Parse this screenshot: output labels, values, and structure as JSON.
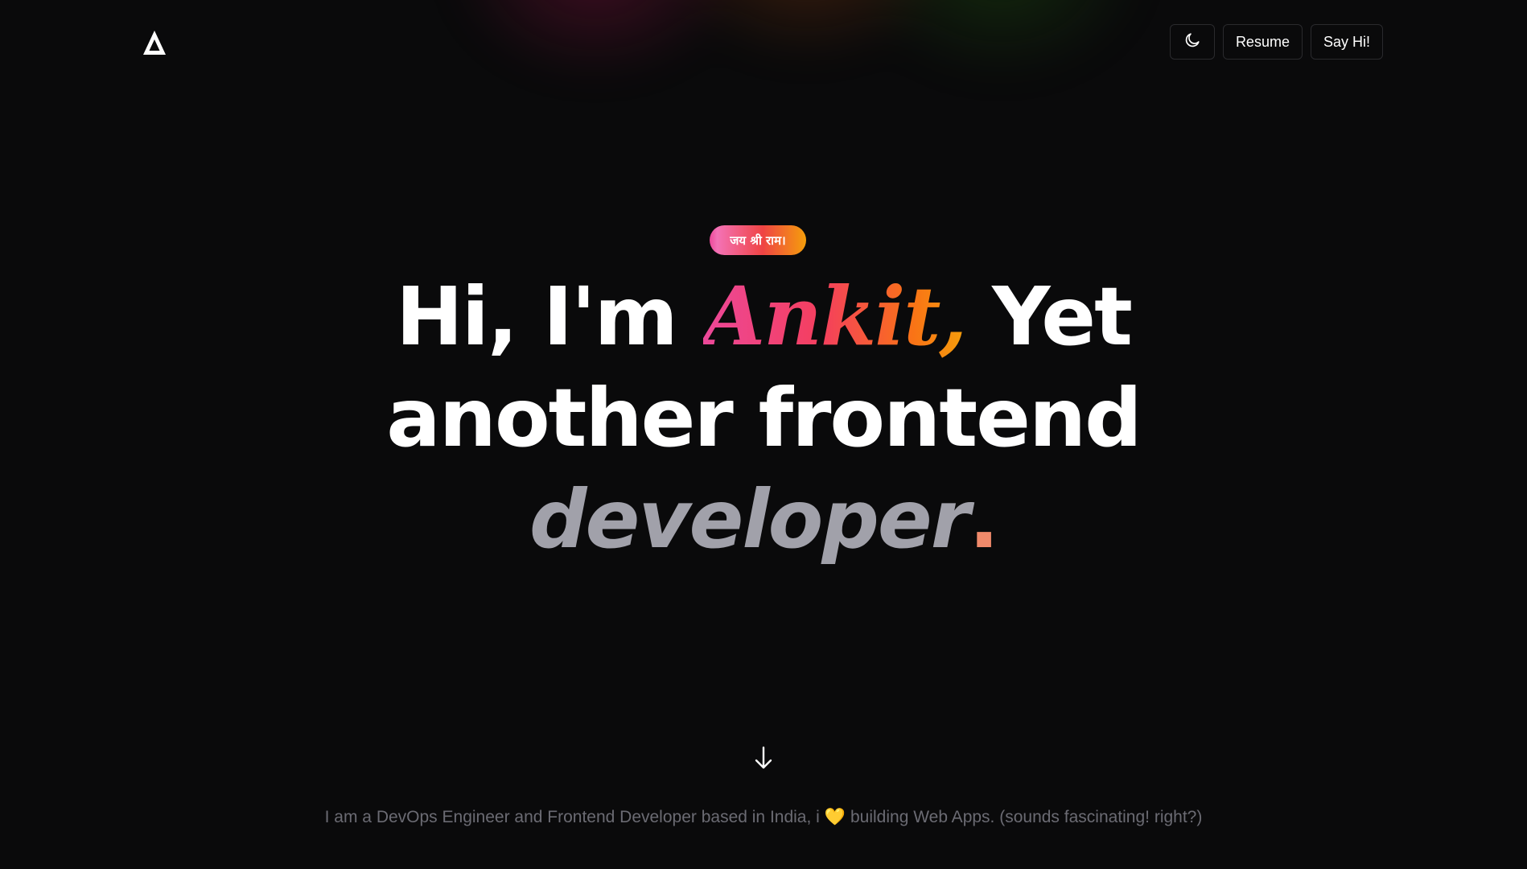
{
  "header": {
    "theme_toggle_icon": "moon-icon",
    "resume_label": "Resume",
    "say_hi_label": "Say Hi!"
  },
  "hero": {
    "badge_text": "जय श्री राम।",
    "greeting": "Hi, I'm",
    "name": "Ankit,",
    "after_name": "Yet",
    "line2": "another frontend",
    "role": "developer",
    "role_dot": "."
  },
  "tagline": {
    "before_heart": "I am a DevOps Engineer and Frontend Developer based in India, i",
    "heart": "💛",
    "after_heart": "building Web Apps. (sounds fascinating! right?)"
  },
  "colors": {
    "background": "#0a0a0b",
    "accent_pink": "#ec4899",
    "accent_orange": "#f59e0b",
    "muted_text": "#6b6b73",
    "role_gray": "#a1a1aa"
  }
}
